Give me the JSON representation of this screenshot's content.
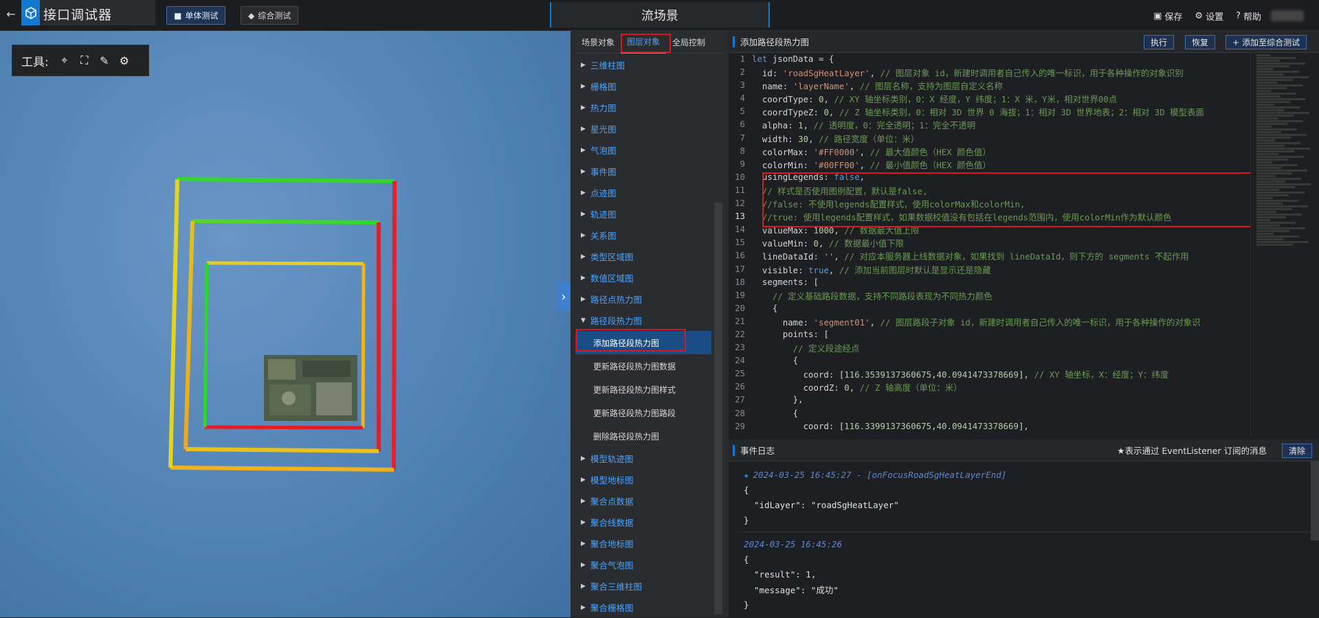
{
  "app": {
    "title": "接口调试器",
    "scene_title": "流场景"
  },
  "header": {
    "tabs": [
      {
        "label": "单体测试",
        "active": true
      },
      {
        "label": "综合测试",
        "active": false
      }
    ],
    "actions": {
      "save": "保存",
      "settings": "设置",
      "help": "帮助"
    }
  },
  "viewport": {
    "tools_label": "工具:"
  },
  "midpanel": {
    "subtabs": [
      "场景对象",
      "图层对象",
      "全局控制"
    ],
    "active_subtab": "图层对象",
    "items_before": [
      "三维柱图",
      "栅格图",
      "热力图",
      "星光图",
      "气泡图",
      "事件图",
      "点迹图",
      "轨迹图",
      "关系图",
      "类型区域图",
      "数值区域图",
      "路径点热力图"
    ],
    "expanded": "路径段热力图",
    "sub_items": [
      "添加路径段热力图",
      "更新路径段热力图数据",
      "更新路径段热力图样式",
      "更新路径段热力图路段",
      "删除路径段热力图"
    ],
    "items_after": [
      "模型轨迹图",
      "模型地标图",
      "聚合点数据",
      "聚合线数据",
      "聚合地标图",
      "聚合气泡图",
      "聚合三维柱图",
      "聚合栅格图"
    ]
  },
  "editor": {
    "title": "添加路径段热力图",
    "buttons": {
      "run": "执行",
      "restore": "恢复",
      "add": "添加至综合测试"
    },
    "current_line": 13,
    "lines": [
      [
        [
          "kw",
          "let "
        ],
        [
          "src",
          "jsonData = {"
        ]
      ],
      [
        [
          "src",
          "  id: "
        ],
        [
          "str",
          "'roadSgHeatLayer'"
        ],
        [
          "src",
          ", "
        ],
        [
          "cm",
          "// 图层对象 id，新建时调用者自己传入的唯一标识，用于各种操作的对象识别"
        ]
      ],
      [
        [
          "src",
          "  name: "
        ],
        [
          "str",
          "'layerName'"
        ],
        [
          "src",
          ", "
        ],
        [
          "cm",
          "// 图层名称，支持为图层自定义名称"
        ]
      ],
      [
        [
          "src",
          "  coordType: "
        ],
        [
          "num",
          "0"
        ],
        [
          "src",
          ", "
        ],
        [
          "cm",
          "// XY 轴坐标类别，0：X 经度，Y 纬度；1：X 米，Y米，相对世界00点"
        ]
      ],
      [
        [
          "src",
          "  coordTypeZ: "
        ],
        [
          "num",
          "0"
        ],
        [
          "src",
          ", "
        ],
        [
          "cm",
          "// Z 轴坐标类别，0：相对 3D 世界 0 海拔；1：相对 3D 世界地表；2：相对 3D 模型表面"
        ]
      ],
      [
        [
          "src",
          "  alpha: "
        ],
        [
          "num",
          "1"
        ],
        [
          "src",
          ", "
        ],
        [
          "cm",
          "// 透明度，0：完全透明；1：完全不透明"
        ]
      ],
      [
        [
          "src",
          "  width: "
        ],
        [
          "num",
          "30"
        ],
        [
          "src",
          ", "
        ],
        [
          "cm",
          "// 路径宽度（单位：米）"
        ]
      ],
      [
        [
          "src",
          "  colorMax: "
        ],
        [
          "str",
          "'#FF0000'"
        ],
        [
          "src",
          ", "
        ],
        [
          "cm",
          "// 最大值颜色（HEX 颜色值）"
        ]
      ],
      [
        [
          "src",
          "  colorMin: "
        ],
        [
          "str",
          "'#00FF00'"
        ],
        [
          "src",
          ", "
        ],
        [
          "cm",
          "// 最小值颜色（HEX 颜色值）"
        ]
      ],
      [
        [
          "src",
          "  usingLegends: "
        ],
        [
          "kw",
          "false"
        ],
        [
          "src",
          ","
        ]
      ],
      [
        [
          "cm",
          "  // 样式是否使用图例配置，默认是false,"
        ]
      ],
      [
        [
          "cm",
          "  //false: 不使用legends配置样式，使用colorMax和colorMin,"
        ]
      ],
      [
        [
          "cm",
          "  //true: 使用legends配置样式，如果数据校值没有包括在legends范围内，使用colorMin作为默认颜色"
        ]
      ],
      [
        [
          "src",
          "  valueMax: "
        ],
        [
          "num",
          "1000"
        ],
        [
          "src",
          ", "
        ],
        [
          "cm",
          "// 数据最大值上限"
        ]
      ],
      [
        [
          "src",
          "  valueMin: "
        ],
        [
          "num",
          "0"
        ],
        [
          "src",
          ", "
        ],
        [
          "cm",
          "// 数据最小值下限"
        ]
      ],
      [
        [
          "src",
          "  lineDataId: "
        ],
        [
          "str",
          "''"
        ],
        [
          "src",
          ", "
        ],
        [
          "cm",
          "// 对应本服务器上线数据对象，如果找到 lineDataId，则下方的 segments 不起作用"
        ]
      ],
      [
        [
          "src",
          "  visible: "
        ],
        [
          "kw",
          "true"
        ],
        [
          "src",
          ", "
        ],
        [
          "cm",
          "// 添加当前图层时默认是显示还是隐藏"
        ]
      ],
      [
        [
          "src",
          "  segments: ["
        ]
      ],
      [
        [
          "cm",
          "    // 定义基础路段数据，支持不同路段表现为不同热力颜色"
        ]
      ],
      [
        [
          "src",
          "    {"
        ]
      ],
      [
        [
          "src",
          "      name: "
        ],
        [
          "str",
          "'segment01'"
        ],
        [
          "src",
          ", "
        ],
        [
          "cm",
          "// 图层路段子对象 id，新建时调用者自己传入的唯一标识，用于各种操作的对象识"
        ]
      ],
      [
        [
          "src",
          "      points: ["
        ]
      ],
      [
        [
          "cm",
          "        // 定义段途经点"
        ]
      ],
      [
        [
          "src",
          "        {"
        ]
      ],
      [
        [
          "src",
          "          coord: ["
        ],
        [
          "num",
          "116.3539137360675"
        ],
        [
          "src",
          ","
        ],
        [
          "num",
          "40.0941473378669"
        ],
        [
          "src",
          "], "
        ],
        [
          "cm",
          "// XY 轴坐标，X：经度；Y：纬度"
        ]
      ],
      [
        [
          "src",
          "          coordZ: "
        ],
        [
          "num",
          "0"
        ],
        [
          "src",
          ", "
        ],
        [
          "cm",
          "// Z 轴高度（单位：米）"
        ]
      ],
      [
        [
          "src",
          "        },"
        ]
      ],
      [
        [
          "src",
          "        {"
        ]
      ],
      [
        [
          "src",
          "          coord: ["
        ],
        [
          "num",
          "116.3399137360675"
        ],
        [
          "src",
          ","
        ],
        [
          "num",
          "40.0941473378669"
        ],
        [
          "src",
          "],"
        ]
      ]
    ]
  },
  "eventlog": {
    "title": "事件日志",
    "hint": "★表示通过 EventListener 订阅的消息",
    "clear": "清除",
    "entries": [
      {
        "starred": true,
        "time": "2024-03-25 16:45:27 - [onFocusRoadSgHeatLayerEnd]",
        "body": [
          "{",
          "  \"idLayer\": \"roadSgHeatLayer\"",
          "}"
        ]
      },
      {
        "starred": false,
        "time": "2024-03-25 16:45:26",
        "body": [
          "{",
          "  \"result\": 1,",
          "  \"message\": \"成功\"",
          "}"
        ]
      }
    ]
  }
}
